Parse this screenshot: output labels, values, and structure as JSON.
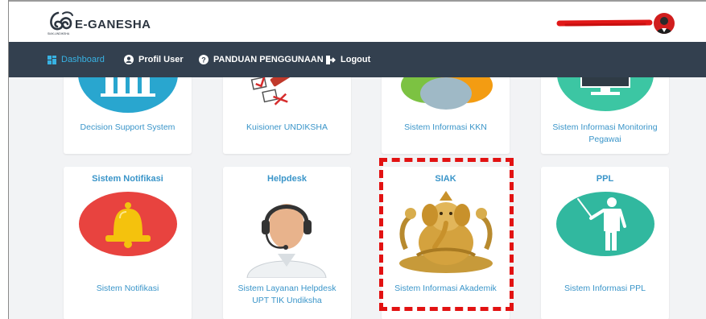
{
  "header": {
    "brand": "E-GANESHA",
    "logo_caption": "SIAK-UNDIKSHA",
    "avatar_icon": "user-avatar-icon",
    "user_name_redacted": true
  },
  "navbar": {
    "items": [
      {
        "label": "Dashboard",
        "icon": "dashboard-icon",
        "active": true
      },
      {
        "label": "Profil User",
        "icon": "user-icon",
        "active": false
      },
      {
        "label": "PANDUAN PENGGUNAAN",
        "icon": "help-icon",
        "active": false
      },
      {
        "label": "Logout",
        "icon": "logout-icon",
        "active": false
      }
    ]
  },
  "cards_row1": [
    {
      "label": "Decision Support System",
      "icon": "bar-chart-icon"
    },
    {
      "label": "Kuisioner UNDIKSHA",
      "icon": "checklist-pencil-icon"
    },
    {
      "label": "Sistem Informasi KKN",
      "icon": "people-icon"
    },
    {
      "label": "Sistem Informasi Monitoring Pegawai",
      "icon": "monitor-icon"
    }
  ],
  "cards_row2": [
    {
      "title": "Sistem Notifikasi",
      "label": "Sistem Notifikasi",
      "icon": "bell-icon"
    },
    {
      "title": "Helpdesk",
      "label": "Sistem Layanan Helpdesk UPT TIK Undiksha",
      "icon": "headset-operator-icon"
    },
    {
      "title": "SIAK",
      "label": "Sistem Informasi Akademik",
      "icon": "ganesha-icon"
    },
    {
      "title": "PPL",
      "label": "Sistem Informasi PPL",
      "icon": "teacher-icon"
    }
  ],
  "colors": {
    "navbar_bg": "#33404f",
    "active_nav": "#38b2e3",
    "card_text": "#3a95c9",
    "highlight": "#e21212"
  }
}
